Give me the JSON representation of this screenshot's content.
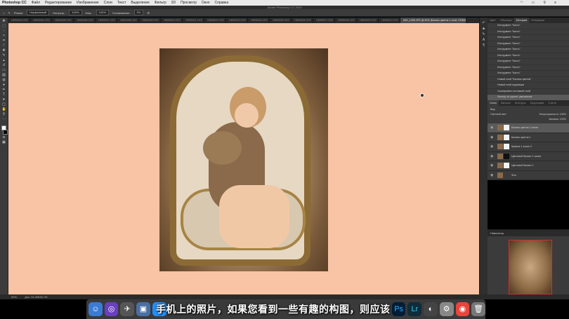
{
  "menubar": {
    "app_name": "Photoshop CC",
    "items": [
      "Файл",
      "Редактирование",
      "Изображение",
      "Слои",
      "Текст",
      "Выделение",
      "Фильтр",
      "3D",
      "Просмотр",
      "Окно",
      "Справка"
    ]
  },
  "window": {
    "title": "Adobe Photoshop CC 2019"
  },
  "options_bar": {
    "mode_label": "Режим:",
    "mode_value": "Нормальный",
    "opacity_label": "Непрозр.:",
    "opacity_value": "100%",
    "flow_label": "Наж.:",
    "flow_value": "100%",
    "smoothing_label": "Сглаживание:",
    "smoothing_value": "0%"
  },
  "tabs": {
    "inactive": [
      "НБЯ4993.CR2",
      "НБЯ4994.CR2",
      "НБЯ4995.CR2",
      "НБЯ4996.CR2",
      "НБЯ4997.CR2",
      "НБЯ4998.CR2",
      "НБЯ4999.CR2",
      "НБЯ5000.CR2",
      "НБЯ5001.CR2",
      "НБЯ5002.CR2",
      "НБЯ5003.CR2",
      "НБЯ5004.CR2",
      "НБЯ5005.CR2",
      "НБЯ5006.CR2",
      "НБЯ5007.CR2",
      "НБЯ5008.CR2",
      "НБЯ5009.CR2",
      "НБЯ5010.CR2"
    ],
    "active": "IMG_1096.JPG @ 50% (Баланс цветов 1 слой, RGB/8)"
  },
  "panel_tabs": {
    "top": [
      "Цвет",
      "Образцы",
      "История",
      "Операции"
    ],
    "layers": [
      "Слои",
      "Каналы",
      "Контуры",
      "Коррекция",
      "Стили"
    ]
  },
  "history": [
    "Инструмент \"Кисть\"",
    "Инструмент \"Кисть\"",
    "Инструмент \"Кисть\"",
    "Инструмент \"Кисть\"",
    "Инструмент \"Кисть\"",
    "Инструмент \"Кисть\"",
    "Инструмент \"Кисть\"",
    "Инструмент \"Кисть\"",
    "Инструмент \"Кисть\"",
    "Новый слой \"Баланс цветов\"",
    "Новый слой коррекции",
    "Скопировать на новый слой",
    "Фильтр по группе: умножение"
  ],
  "layers_controls": {
    "blend_mode": "Светлый свет",
    "opacity": "Непрозрачность: 100%",
    "fill": "Заливка: 100%",
    "filter_label": "Вид"
  },
  "layers": [
    "Баланс цветов 1 копия",
    "Баланс цветов 1",
    "Кривые 1 копия 2",
    "Цветовой баланс 1 копия",
    "Цветовой баланс 1",
    "Фон"
  ],
  "navigator": {
    "title": "Навигатор"
  },
  "status": {
    "zoom": "50%",
    "doc": "Док: 34,3M/68,7M"
  },
  "subtitle": "手机上的照片，如果您看到一些有趣的构图，则应该",
  "dock_icons": [
    "finder-icon",
    "siri-icon",
    "launchpad-icon",
    "preview-icon",
    "safari-icon",
    "photoshop-icon",
    "lightroom-icon",
    "quicktime-icon",
    "system-preferences-icon",
    "chrome-icon",
    "trash-icon"
  ]
}
